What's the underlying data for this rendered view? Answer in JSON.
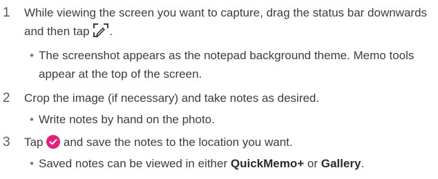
{
  "steps": [
    {
      "number": "1",
      "text_before": "While viewing the screen you want to capture, drag the status bar downwards and then tap",
      "icon": "capture-plus-icon",
      "text_after": ".",
      "bullet": "The screenshot appears as the notepad background theme. Memo tools appear at the top of the screen."
    },
    {
      "number": "2",
      "text": "Crop the image (if necessary) and take notes as desired.",
      "bullet": "Write notes by hand on the photo."
    },
    {
      "number": "3",
      "text_before": "Tap",
      "icon": "checkmark-circle-icon",
      "text_after": "and save the notes to the location you want.",
      "bullet_before": "Saved notes can be viewed in either",
      "bullet_bold1": "QuickMemo+",
      "bullet_middle": "or",
      "bullet_bold2": "Gallery",
      "bullet_end": "."
    }
  ],
  "colors": {
    "accent": "#e0237a",
    "text": "#3c3c3c"
  }
}
